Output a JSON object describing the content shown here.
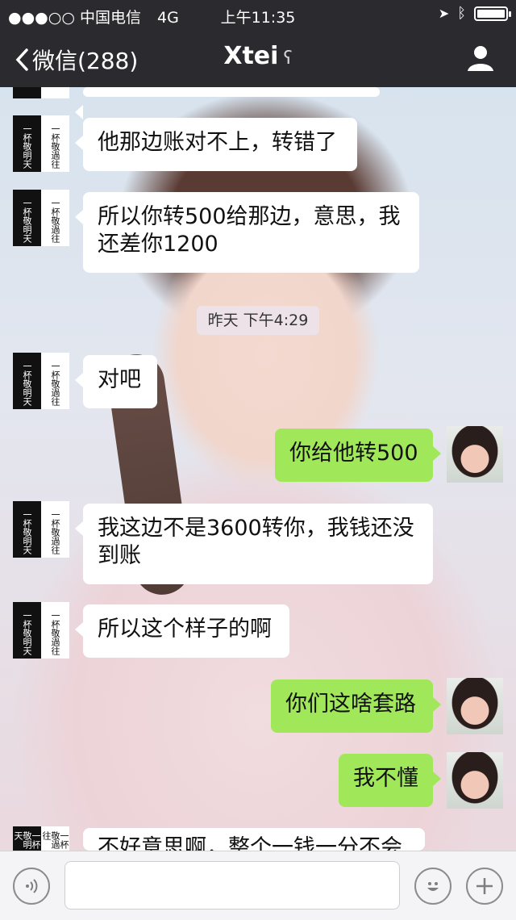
{
  "status_bar": {
    "signal": "●●●○○",
    "carrier": "中国电信",
    "network": "4G",
    "time": "上午11:35",
    "battery_level": 0.9
  },
  "nav": {
    "back_label": "微信(288)",
    "title": "Xtei"
  },
  "avatars": {
    "contact_text_left": "一杯敬明天",
    "contact_text_right": "一杯敬過往"
  },
  "messages": [
    {
      "text": "他那边账对不上，转错了"
    },
    {
      "text": "所以你转500给那边，意思，我还差你1200"
    },
    {
      "text": "对吧"
    },
    {
      "text": "你给他转500"
    },
    {
      "text": "我这边不是3600转你，我钱还没到账"
    },
    {
      "text": "所以这个样子的啊"
    },
    {
      "text": "你们这啥套路"
    },
    {
      "text": "我不懂"
    },
    {
      "text": "不好意思啊，整个一钱一分不会"
    }
  ],
  "time_separator": "昨天 下午4:29",
  "colors": {
    "nav_bg": "#2b2b2f",
    "outgoing_bubble": "#a0e75a",
    "incoming_bubble": "#ffffff"
  },
  "icons": {
    "voice": "voice-icon",
    "emoji": "emoji-icon",
    "plus": "plus-icon",
    "profile": "profile-icon"
  }
}
